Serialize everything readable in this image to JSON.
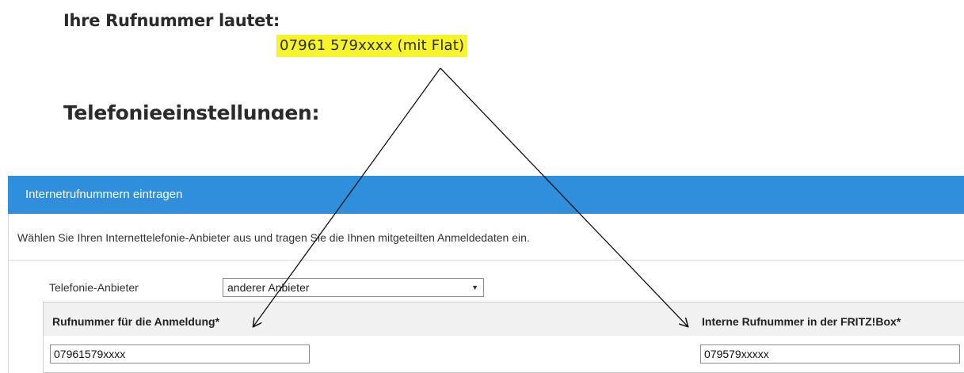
{
  "document": {
    "heading_number": "Ihre Rufnummer lautet:",
    "phone_number_highlight": "07961 579xxxx (mit Flat)",
    "heading_settings": "Telefonieeinstellungen:",
    "highlight_color": "#f7f52a"
  },
  "panel": {
    "title": "Internetrufnummern eintragen",
    "header_color": "#2f8fdc",
    "intro": "Wählen Sie Ihren Internettelefonie-Anbieter aus und tragen Sie die Ihnen mitgeteilten Anmeldedaten ein.",
    "provider_label": "Telefonie-Anbieter",
    "provider_selected": "anderer Anbieter",
    "registration_number_label": "Rufnummer für die Anmeldung*",
    "registration_number_value": "07961579xxxx",
    "internal_number_label": "Interne Rufnummer in der FRITZ!Box*",
    "internal_number_value": "079579xxxxx"
  },
  "annotation": {
    "arrow_icon": "arrow-icon"
  }
}
